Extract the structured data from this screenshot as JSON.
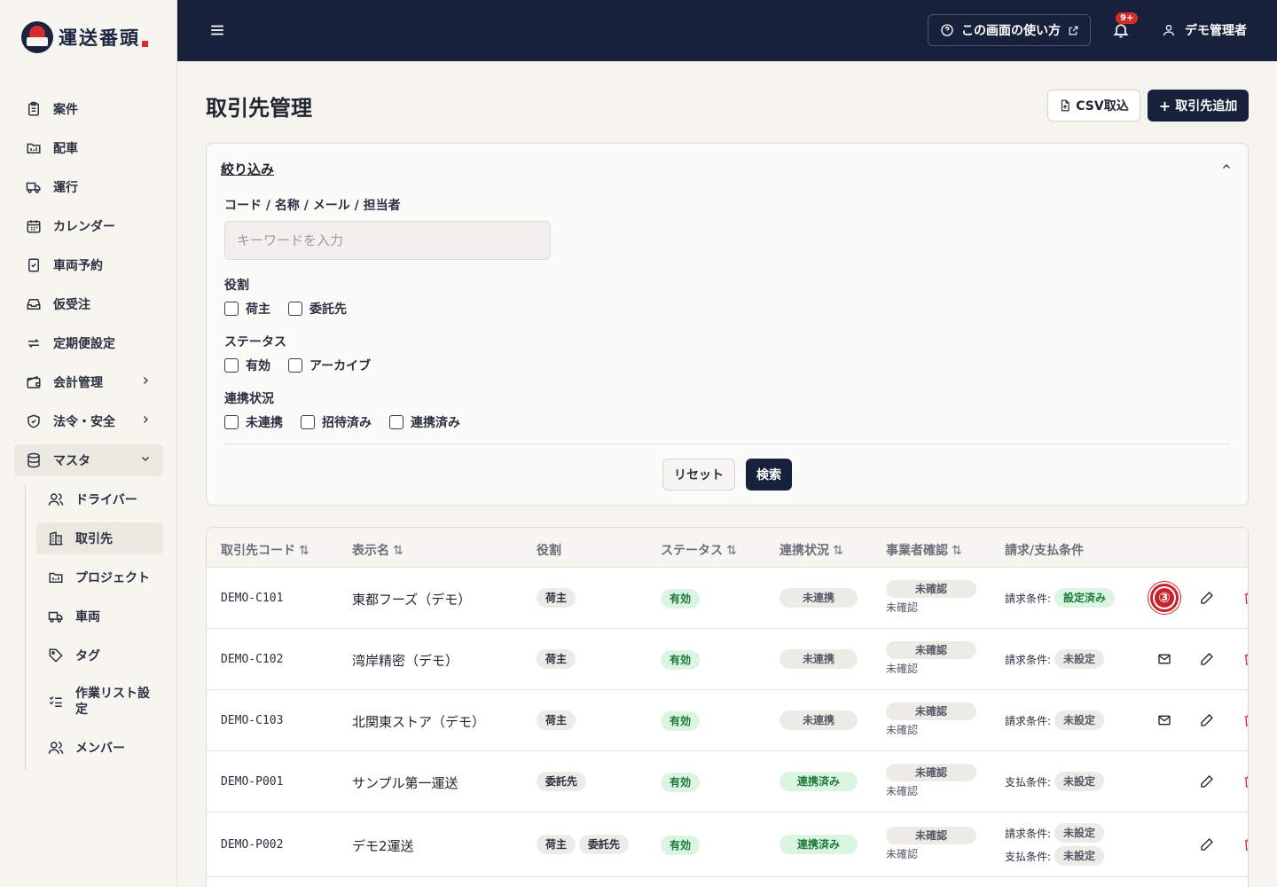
{
  "app": {
    "logo_text": "運送番頭"
  },
  "sidebar": {
    "items": [
      {
        "label": "案件",
        "icon": "clipboard-icon"
      },
      {
        "label": "配車",
        "icon": "folder-icon"
      },
      {
        "label": "運行",
        "icon": "truck-icon"
      },
      {
        "label": "カレンダー",
        "icon": "calendar-icon"
      },
      {
        "label": "車両予約",
        "icon": "clipboard-check-icon"
      },
      {
        "label": "仮受注",
        "icon": "inbox-icon"
      },
      {
        "label": "定期便設定",
        "icon": "repeat-icon"
      },
      {
        "label": "会計管理",
        "icon": "wallet-icon"
      },
      {
        "label": "法令・安全",
        "icon": "shield-icon"
      },
      {
        "label": "マスタ",
        "icon": "database-icon"
      }
    ],
    "sub_items": [
      {
        "label": "ドライバー",
        "icon": "users-icon"
      },
      {
        "label": "取引先",
        "icon": "building-icon"
      },
      {
        "label": "プロジェクト",
        "icon": "folder-icon"
      },
      {
        "label": "車両",
        "icon": "truck-icon"
      },
      {
        "label": "タグ",
        "icon": "tag-icon"
      },
      {
        "label": "作業リスト設定",
        "icon": "list-check-icon"
      },
      {
        "label": "メンバー",
        "icon": "users-icon"
      }
    ]
  },
  "header": {
    "howto_label": "この画面の使い方",
    "notification_count": "9+",
    "user_name": "デモ管理者"
  },
  "page": {
    "title": "取引先管理",
    "csv_label": "CSV取込",
    "add_label": "取引先追加"
  },
  "filter": {
    "title": "絞り込み",
    "keyword_label": "コード / 名称 / メール / 担当者",
    "keyword_placeholder": "キーワードを入力",
    "role_label": "役割",
    "role_options": [
      "荷主",
      "委託先"
    ],
    "status_label": "ステータス",
    "status_options": [
      "有効",
      "アーカイブ"
    ],
    "link_label": "連携状況",
    "link_options": [
      "未連携",
      "招待済み",
      "連携済み"
    ],
    "reset_label": "リセット",
    "search_label": "検索"
  },
  "table": {
    "headers": [
      "取引先コード",
      "表示名",
      "役割",
      "ステータス",
      "連携状況",
      "事業者確認",
      "請求/支払条件"
    ],
    "sort_icon": "⇅",
    "rows": [
      {
        "code": "DEMO-C101",
        "name": "東都フーズ（デモ）",
        "roles": [
          "荷主"
        ],
        "status": "有効",
        "link": "未連携",
        "biz": "未確認",
        "biz_sub": "未確認",
        "terms": [
          {
            "label": "請求条件:",
            "value": "設定済み"
          }
        ],
        "mail": false,
        "marker": "③"
      },
      {
        "code": "DEMO-C102",
        "name": "湾岸精密（デモ）",
        "roles": [
          "荷主"
        ],
        "status": "有効",
        "link": "未連携",
        "biz": "未確認",
        "biz_sub": "未確認",
        "terms": [
          {
            "label": "請求条件:",
            "value": "未設定"
          }
        ],
        "mail": true
      },
      {
        "code": "DEMO-C103",
        "name": "北関東ストア（デモ）",
        "roles": [
          "荷主"
        ],
        "status": "有効",
        "link": "未連携",
        "biz": "未確認",
        "biz_sub": "未確認",
        "terms": [
          {
            "label": "請求条件:",
            "value": "未設定"
          }
        ],
        "mail": true
      },
      {
        "code": "DEMO-P001",
        "name": "サンプル第一運送",
        "roles": [
          "委託先"
        ],
        "status": "有効",
        "link": "連携済み",
        "biz": "未確認",
        "biz_sub": "未確認",
        "terms": [
          {
            "label": "支払条件:",
            "value": "未設定"
          }
        ],
        "mail": false
      },
      {
        "code": "DEMO-P002",
        "name": "デモ2運送",
        "roles": [
          "荷主",
          "委託先"
        ],
        "status": "有効",
        "link": "連携済み",
        "biz": "未確認",
        "biz_sub": "未確認",
        "terms": [
          {
            "label": "請求条件:",
            "value": "未設定"
          },
          {
            "label": "支払条件:",
            "value": "未設定"
          }
        ],
        "mail": false
      }
    ]
  },
  "colors": {
    "navy": "#17213b",
    "accent_red": "#d42b2b",
    "green": "#1b7a3a"
  }
}
